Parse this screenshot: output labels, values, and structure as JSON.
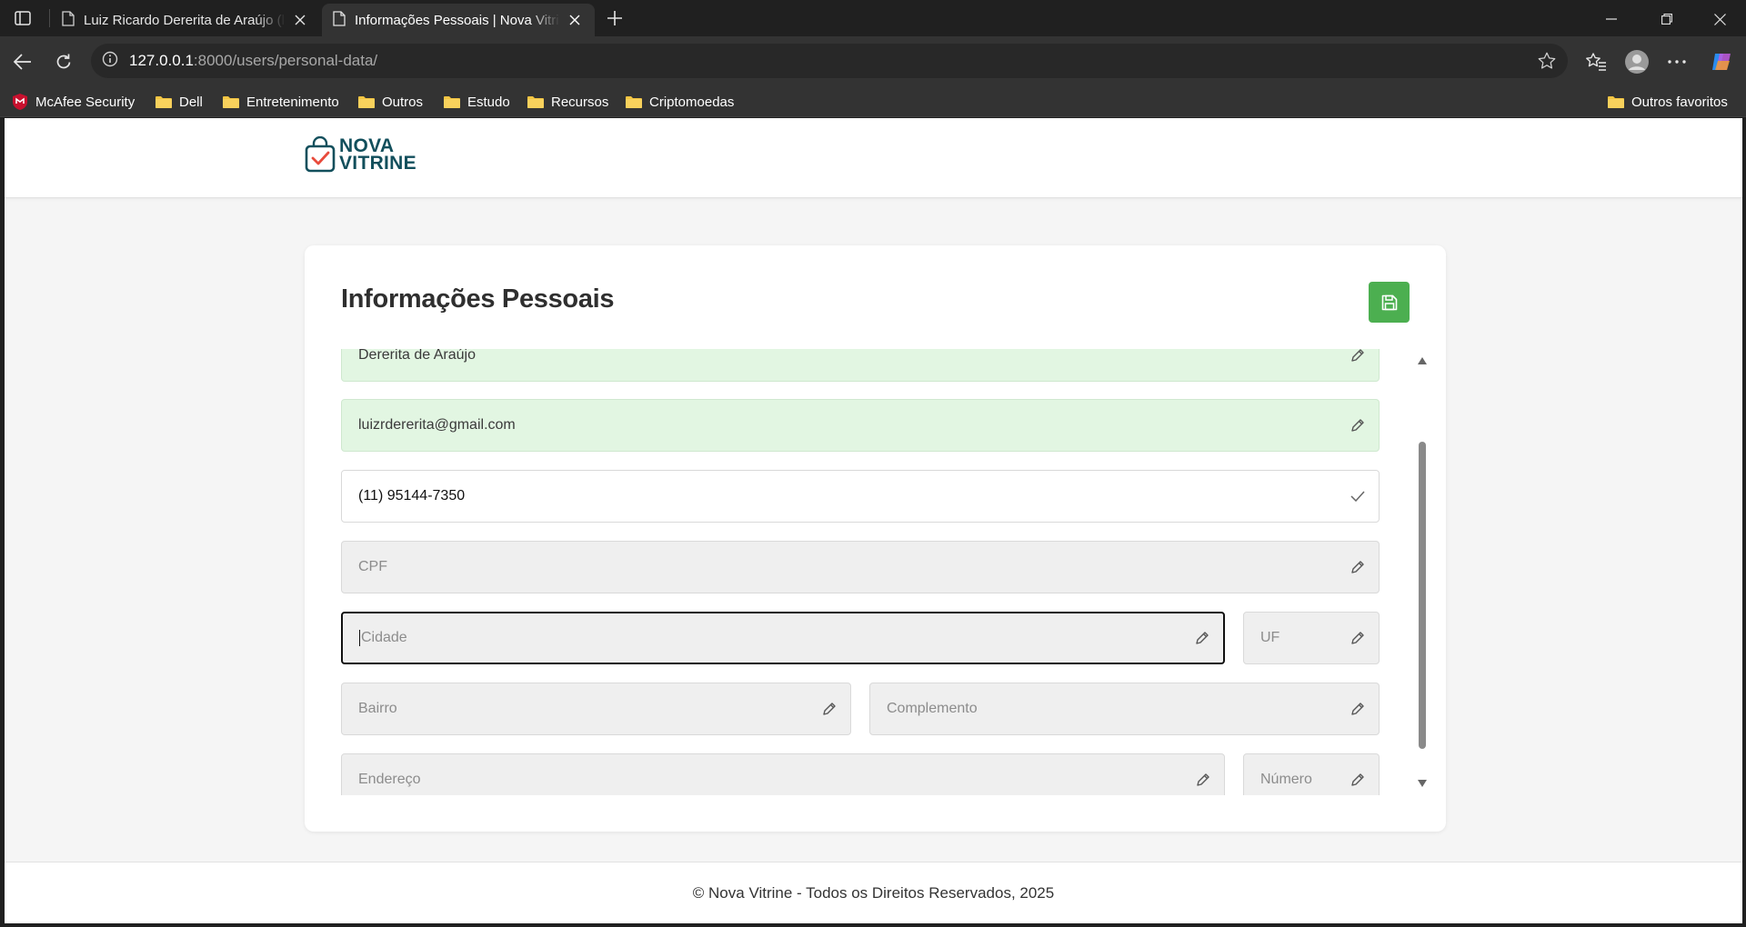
{
  "browser": {
    "tabs": [
      {
        "title": "Luiz Ricardo Dererita de Araújo (luizrdererita)",
        "active": false
      },
      {
        "title": "Informações Pessoais | Nova Vitrine",
        "active": true
      }
    ],
    "url_host": "127.0.0.1",
    "url_path": ":8000/users/personal-data/",
    "bookmarks": [
      "McAfee Security",
      "Dell",
      "Entretenimento",
      "Outros",
      "Estudo",
      "Recursos",
      "Criptomoedas"
    ],
    "other_favorites": "Outros favoritos"
  },
  "header": {
    "logo_line1": "NOVA",
    "logo_line2": "VITRINE"
  },
  "card": {
    "title": "Informações Pessoais",
    "fields": {
      "last_name": "Dererita de Araújo",
      "email": "luizrdererita@gmail.com",
      "phone": "(11) 95144-7350",
      "cpf_placeholder": "CPF",
      "city_placeholder": "Cidade",
      "uf_placeholder": "UF",
      "neighborhood_placeholder": "Bairro",
      "complement_placeholder": "Complemento",
      "address_placeholder": "Endereço",
      "number_placeholder": "Número"
    }
  },
  "footer": {
    "text": "© Nova Vitrine - Todos os Direitos Reservados, 2025"
  },
  "colors": {
    "save_button": "#4caf50",
    "filled_field": "#e2f6e2",
    "empty_field": "#efefef",
    "brand": "#124f5c",
    "logo_check": "#e84b3c"
  }
}
